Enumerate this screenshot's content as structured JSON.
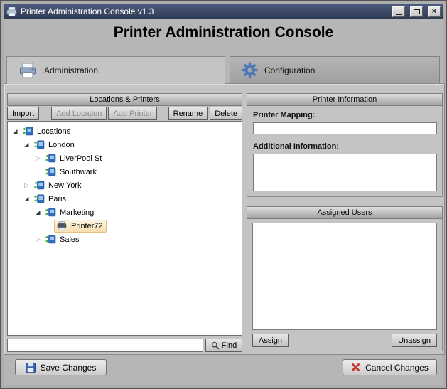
{
  "window": {
    "title": "Printer Administration Console v1.3"
  },
  "header": {
    "title": "Printer Administration Console"
  },
  "tabs": [
    {
      "label": "Administration",
      "active": true
    },
    {
      "label": "Configuration",
      "active": false
    }
  ],
  "locations_panel": {
    "title": "Locations & Printers",
    "toolbar": [
      {
        "label": "Import",
        "enabled": true
      },
      {
        "label": "Add Location",
        "enabled": false
      },
      {
        "label": "Add Printer",
        "enabled": false
      },
      {
        "label": "Rename",
        "enabled": true
      },
      {
        "label": "Delete",
        "enabled": true
      }
    ],
    "tree": [
      {
        "label": "Locations",
        "level": 0,
        "expanded": true,
        "icon": "location",
        "selected": false
      },
      {
        "label": "London",
        "level": 1,
        "expanded": true,
        "icon": "location",
        "selected": false
      },
      {
        "label": "LiverPool St",
        "level": 2,
        "expanded": false,
        "icon": "location",
        "selected": false
      },
      {
        "label": "Southwark",
        "level": 2,
        "expanded": null,
        "icon": "location",
        "selected": false
      },
      {
        "label": "New York",
        "level": 1,
        "expanded": false,
        "icon": "location",
        "selected": false
      },
      {
        "label": "Paris",
        "level": 1,
        "expanded": true,
        "icon": "location",
        "selected": false
      },
      {
        "label": "Marketing",
        "level": 2,
        "expanded": true,
        "icon": "location",
        "selected": false
      },
      {
        "label": "Printer72",
        "level": 3,
        "expanded": null,
        "icon": "printer",
        "selected": true
      },
      {
        "label": "Sales",
        "level": 2,
        "expanded": false,
        "icon": "location",
        "selected": false
      }
    ],
    "find": {
      "value": "",
      "button_label": "Find"
    }
  },
  "printer_info": {
    "title": "Printer Information",
    "mapping_label": "Printer Mapping:",
    "mapping_value": "",
    "additional_label": "Additional Information:",
    "additional_value": ""
  },
  "assigned_users": {
    "title": "Assigned Users",
    "users": [],
    "assign_label": "Assign",
    "unassign_label": "Unassign"
  },
  "footer": {
    "save_label": "Save Changes",
    "cancel_label": "Cancel Changes"
  }
}
